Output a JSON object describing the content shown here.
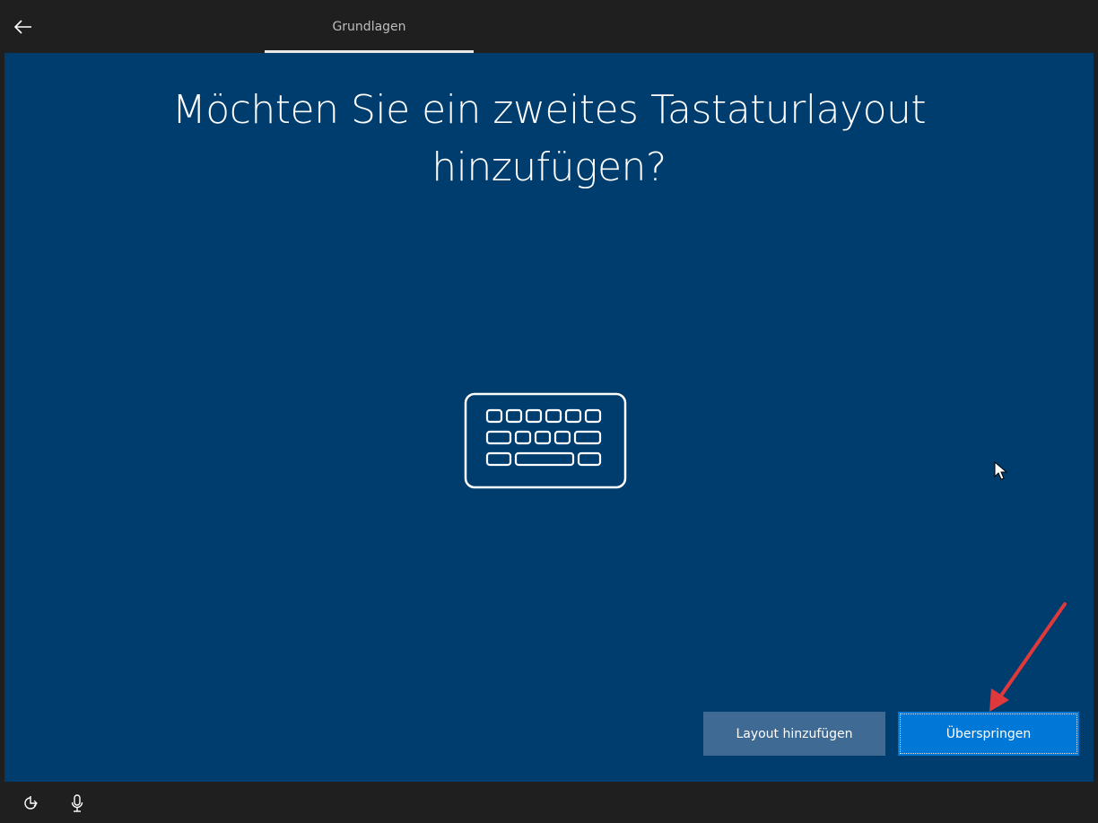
{
  "header": {
    "back_icon": "back-arrow-icon",
    "tab_label": "Grundlagen"
  },
  "main": {
    "title_line1": "Möchten Sie ein zweites Tastaturlayout",
    "title_line2": "hinzufügen?",
    "illustration_icon": "keyboard-icon",
    "buttons": {
      "add_layout": "Layout hinzufügen",
      "skip": "Überspringen"
    }
  },
  "footer": {
    "ease_of_access_icon": "ease-of-access-icon",
    "microphone_icon": "microphone-icon"
  },
  "colors": {
    "background": "#003d6f",
    "bar": "#1f1f1f",
    "primary_button": "#0078d7",
    "secondary_button": "#3f6a93",
    "annotation_arrow": "#e0393b"
  }
}
